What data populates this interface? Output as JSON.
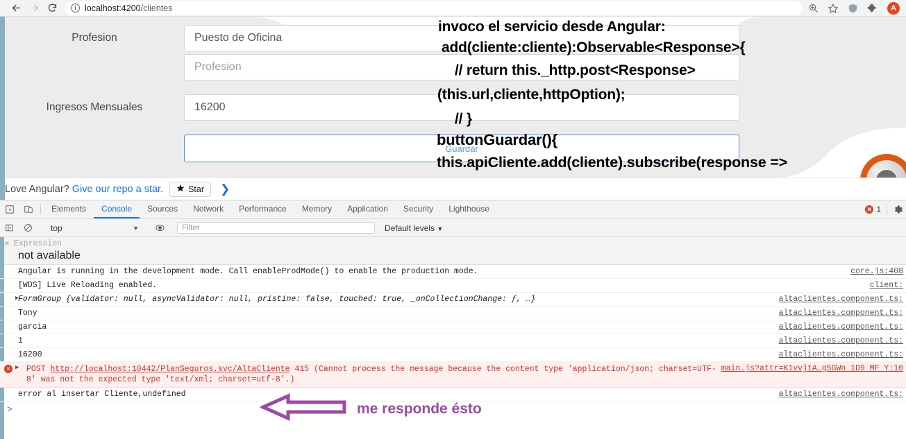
{
  "browser": {
    "back_icon": "arrow-left-icon",
    "forward_icon": "arrow-right-icon",
    "reload_icon": "reload-icon",
    "info_icon": "info-circle-icon",
    "url_host": "localhost:4200",
    "url_path": "/clientes",
    "zoom_icon": "zoom-search-icon",
    "bookmark_icon": "star-outline-icon",
    "shield_icon": "shield-icon",
    "extensions_icon": "puzzle-piece-icon",
    "avatar_label": "A",
    "avatar_color": "#e8441f"
  },
  "app": {
    "fields": [
      {
        "label": "Profesion",
        "value": "Puesto de Oficina",
        "is_placeholder": false
      },
      {
        "label": "",
        "value": "Profesion",
        "is_placeholder": true
      },
      {
        "label": "Ingresos Mensuales",
        "value": "16200",
        "is_placeholder": false
      }
    ],
    "submit_button": "Guardar",
    "banner": {
      "text": "Love Angular?",
      "link": "Give our repo a star.",
      "star_button": "Star",
      "star_icon": "star-filled-icon",
      "chevron_icon": "chevron-right-icon"
    },
    "logo_name": "angular-spinner-logo"
  },
  "annotations": {
    "code_lines": [
      "invoco el servicio desde Angular:",
      "add(cliente:cliente):Observable<Response>{",
      "//   return this._http.post<Response>",
      "(this.url,cliente,httpOption);",
      "// }",
      "buttonGuardar(){",
      "this.apiCliente.add(cliente).subscribe(response =>"
    ],
    "arrow_note": "me responde ésto",
    "arrow_icon": "left-arrow-annotation",
    "arrow_color": "#9b4aa5"
  },
  "devtools": {
    "inspect_icon": "inspect-element-icon",
    "device_icon": "device-toolbar-icon",
    "tabs": [
      {
        "label": "Elements",
        "active": false
      },
      {
        "label": "Console",
        "active": true
      },
      {
        "label": "Sources",
        "active": false
      },
      {
        "label": "Network",
        "active": false
      },
      {
        "label": "Performance",
        "active": false
      },
      {
        "label": "Memory",
        "active": false
      },
      {
        "label": "Application",
        "active": false
      },
      {
        "label": "Security",
        "active": false
      },
      {
        "label": "Lighthouse",
        "active": false
      }
    ],
    "error_count": "1",
    "settings_icon": "gear-icon",
    "toolbar": {
      "sidebar_icon": "console-sidebar-icon",
      "clear_icon": "clear-console-icon",
      "context": "top",
      "eye_icon": "live-expression-eye-icon",
      "filter_placeholder": "Filter",
      "levels_label": "Default levels"
    },
    "watch": {
      "close_icon": "close-expression-icon",
      "expression": "Expression",
      "value": "not available"
    },
    "logs": [
      {
        "type": "info",
        "text": "Angular is running in the development mode. Call enableProdMode() to enable the production mode.",
        "source": "core.js:408"
      },
      {
        "type": "info",
        "text": "[WDS] Live Reloading enabled.",
        "source": "client:"
      },
      {
        "type": "object",
        "expandable": true,
        "name": "FormGroup",
        "props": "{validator: null, asyncValidator: null, pristine: false, touched: true, _onCollectionChange: ƒ, …}",
        "source": "altaclientes.component.ts:"
      },
      {
        "type": "info",
        "text": "Tony",
        "source": "altaclientes.component.ts:"
      },
      {
        "type": "info",
        "text": "garcia",
        "source": "altaclientes.component.ts:"
      },
      {
        "type": "info",
        "text": "1",
        "source": "altaclientes.component.ts:"
      },
      {
        "type": "info",
        "text": "16200",
        "source": "altaclientes.component.ts:"
      },
      {
        "type": "error",
        "method": "POST",
        "url": "http://localhost:10442/PlanSeguros.svc/AltaCliente",
        "text": "415 (Cannot process the message because the content type 'application/json; charset=UTF-8' was not the expected type 'text/xml; charset=utf-8'.)",
        "source": "main.js?attr=K1vvjtA…g5GWn 1D9 MF Y:10"
      },
      {
        "type": "info",
        "text": "error al insertar Cliente,undefined",
        "source": "altaclientes.component.ts:"
      }
    ],
    "prompt": ">"
  }
}
